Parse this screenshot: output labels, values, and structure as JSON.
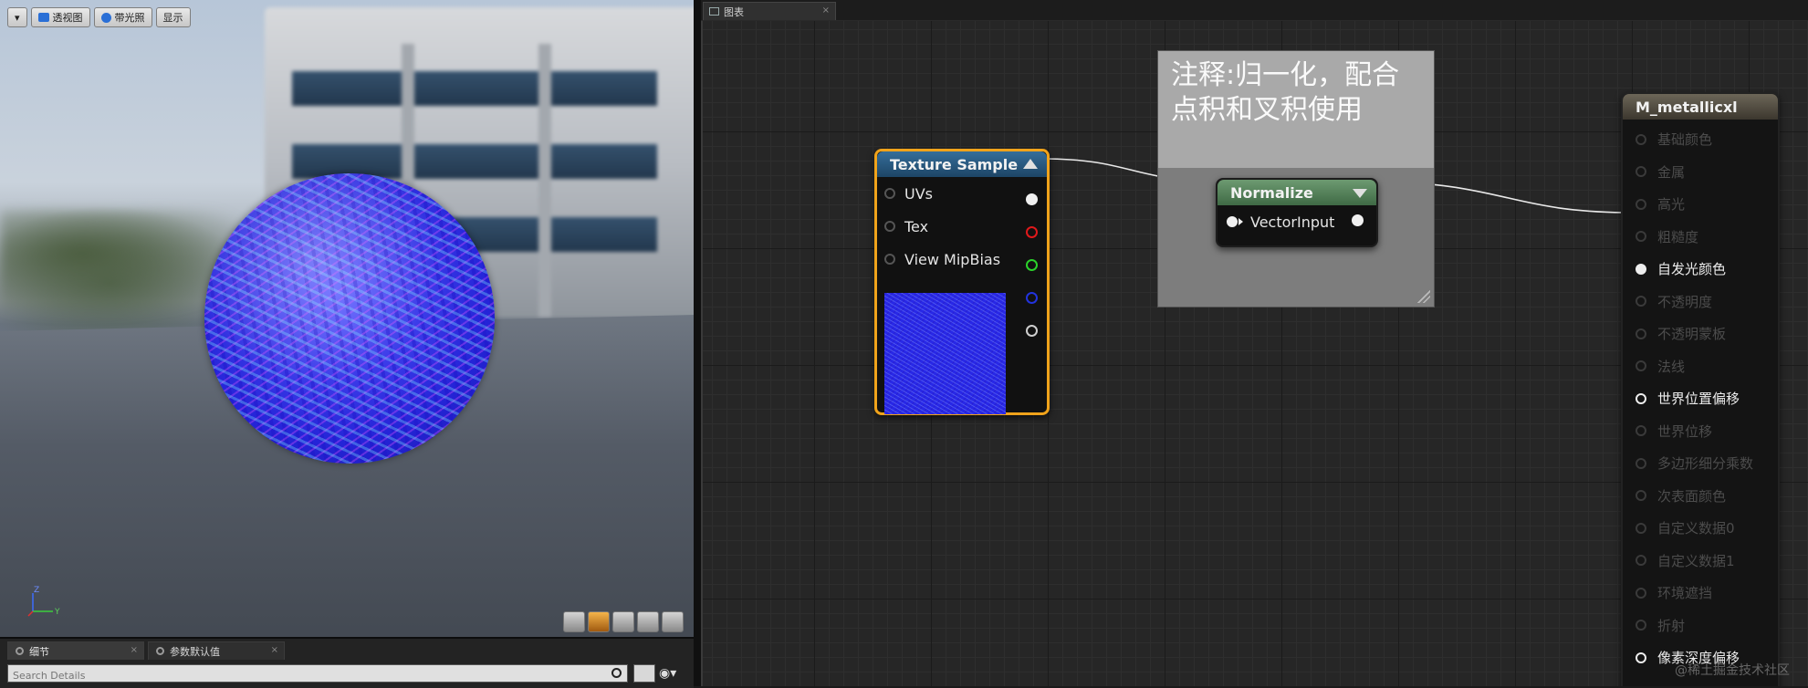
{
  "viewport": {
    "toolbar": {
      "menu_arrow": "▾",
      "perspective": "透视图",
      "lit": "带光照",
      "show": "显示"
    },
    "axes": {
      "z": "Z",
      "y": "Y"
    }
  },
  "details_panel": {
    "tabs": [
      {
        "label": "细节"
      },
      {
        "label": "参数默认值"
      }
    ],
    "search_placeholder": "Search Details"
  },
  "graph": {
    "tab_label": "图表",
    "comment_text": "注释:归一化，配合点积和叉积使用",
    "texture_sample": {
      "title": "Texture Sample",
      "inputs": [
        "UVs",
        "Tex",
        "View MipBias"
      ],
      "output_colors": [
        "#f0f0f0",
        "#e0191b",
        "#2bd22b",
        "#2233dd",
        "#cfcfcf"
      ]
    },
    "normalize": {
      "title": "Normalize",
      "input": "VectorInput"
    },
    "material": {
      "title": "M_metallicxl",
      "inputs": [
        {
          "label": "基础颜色",
          "state": "dim"
        },
        {
          "label": "金属",
          "state": "dim"
        },
        {
          "label": "高光",
          "state": "dim"
        },
        {
          "label": "粗糙度",
          "state": "dim"
        },
        {
          "label": "自发光颜色",
          "state": "connected"
        },
        {
          "label": "不透明度",
          "state": "dim"
        },
        {
          "label": "不透明蒙板",
          "state": "dim"
        },
        {
          "label": "法线",
          "state": "dim"
        },
        {
          "label": "世界位置偏移",
          "state": "active"
        },
        {
          "label": "世界位移",
          "state": "dim"
        },
        {
          "label": "多边形细分乘数",
          "state": "dim"
        },
        {
          "label": "次表面颜色",
          "state": "dim"
        },
        {
          "label": "自定义数据0",
          "state": "dim"
        },
        {
          "label": "自定义数据1",
          "state": "dim"
        },
        {
          "label": "环境遮挡",
          "state": "dim"
        },
        {
          "label": "折射",
          "state": "dim"
        },
        {
          "label": "像素深度偏移",
          "state": "active"
        }
      ]
    },
    "watermark": "@稀土掘金技术社区"
  }
}
